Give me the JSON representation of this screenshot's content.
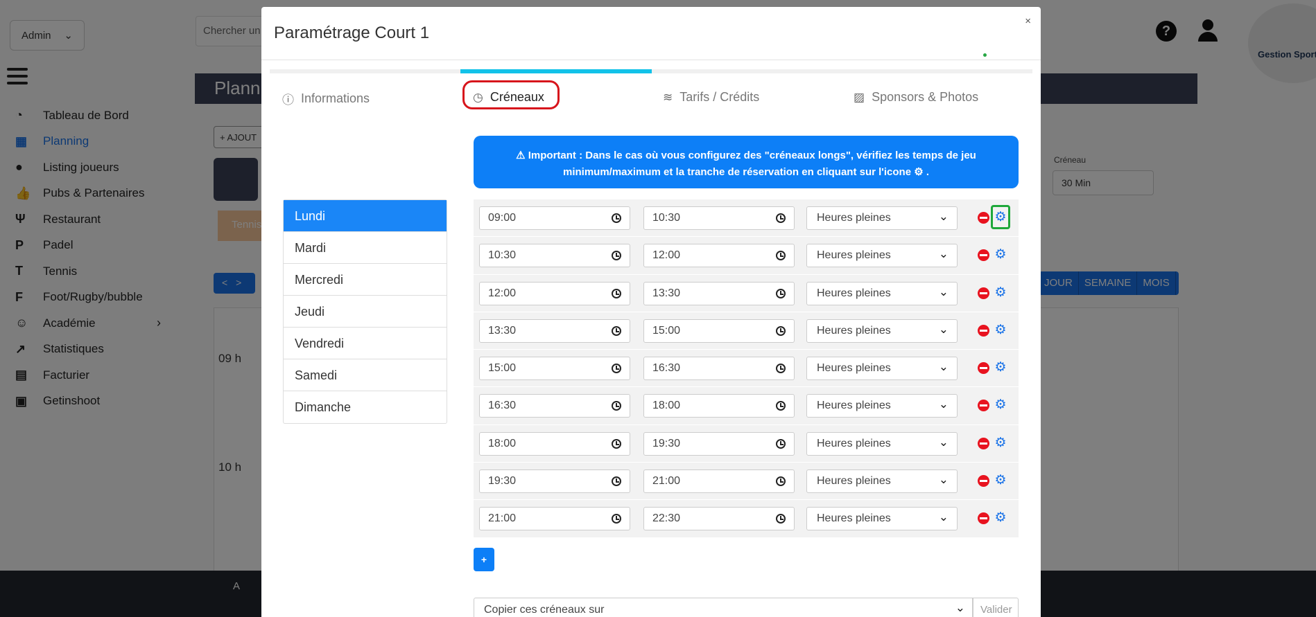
{
  "background": {
    "role_select": "Admin",
    "search_placeholder": "Chercher un",
    "header_title": "Plann",
    "add_button": "AJOUT",
    "tennis_tag": "Tennis",
    "nav_buttons": "<>",
    "hours": [
      "09 h",
      "10 h"
    ],
    "creneau_label": "Créneau",
    "creneau_value": "30 Min",
    "views": [
      "JOUR",
      "SEMAINE",
      "MOIS"
    ],
    "logo_text": "Gestion Sports",
    "footer_user": "A"
  },
  "sidebar": {
    "items": [
      {
        "label": "Tableau de Bord",
        "icon": "dashboard-icon",
        "glyph": "◔"
      },
      {
        "label": "Planning",
        "icon": "calendar-icon",
        "glyph": "▦"
      },
      {
        "label": "Listing joueurs",
        "icon": "user-icon",
        "glyph": "●"
      },
      {
        "label": "Pubs & Partenaires",
        "icon": "thumbs-up-icon",
        "glyph": "👍"
      },
      {
        "label": "Restaurant",
        "icon": "utensils-icon",
        "glyph": "Ψ"
      },
      {
        "label": "Padel",
        "icon": "padel-icon",
        "glyph": "P"
      },
      {
        "label": "Tennis",
        "icon": "tennis-icon",
        "glyph": "T"
      },
      {
        "label": "Foot/Rugby/bubble",
        "icon": "foot-icon",
        "glyph": "F"
      },
      {
        "label": "Académie",
        "icon": "academy-icon",
        "glyph": "☺"
      },
      {
        "label": "Statistiques",
        "icon": "chart-icon",
        "glyph": "↗"
      },
      {
        "label": "Facturier",
        "icon": "invoice-icon",
        "glyph": "▤"
      },
      {
        "label": "Getinshoot",
        "icon": "photos-icon",
        "glyph": "▣"
      }
    ]
  },
  "modal": {
    "title": "Paramétrage Court 1",
    "close": "×",
    "tabs": [
      {
        "label": "Informations",
        "icon": "info-icon",
        "glyph": "ⓘ"
      },
      {
        "label": "Créneaux",
        "icon": "clock-icon",
        "glyph": "◷"
      },
      {
        "label": "Tarifs / Crédits",
        "icon": "coins-icon",
        "glyph": "≋"
      },
      {
        "label": "Sponsors & Photos",
        "icon": "images-icon",
        "glyph": "▨"
      }
    ],
    "days": [
      "Lundi",
      "Mardi",
      "Mercredi",
      "Jeudi",
      "Vendredi",
      "Samedi",
      "Dimanche"
    ],
    "alert": {
      "strong": "Important :",
      "text": "Dans le cas où vous configurez des \"créneaux longs\", vérifiez les temps de jeu minimum/maximum et la tranche de réservation en cliquant sur l'icone",
      "end": "."
    },
    "slots": [
      {
        "start": "09:00",
        "end": "10:30",
        "type": "Heures pleines"
      },
      {
        "start": "10:30",
        "end": "12:00",
        "type": "Heures pleines"
      },
      {
        "start": "12:00",
        "end": "13:30",
        "type": "Heures pleines"
      },
      {
        "start": "13:30",
        "end": "15:00",
        "type": "Heures pleines"
      },
      {
        "start": "15:00",
        "end": "16:30",
        "type": "Heures pleines"
      },
      {
        "start": "16:30",
        "end": "18:00",
        "type": "Heures pleines"
      },
      {
        "start": "18:00",
        "end": "19:30",
        "type": "Heures pleines"
      },
      {
        "start": "19:30",
        "end": "21:00",
        "type": "Heures pleines"
      },
      {
        "start": "21:00",
        "end": "22:30",
        "type": "Heures pleines"
      }
    ],
    "add_label": "+",
    "copy_placeholder": "Copier ces créneaux sur",
    "valider_label": "Valider"
  },
  "colors": {
    "primary": "#0d7ff7",
    "tab_indicator": "#12c2e9",
    "highlight_red": "#d7151c",
    "highlight_green": "#1fa83b"
  }
}
